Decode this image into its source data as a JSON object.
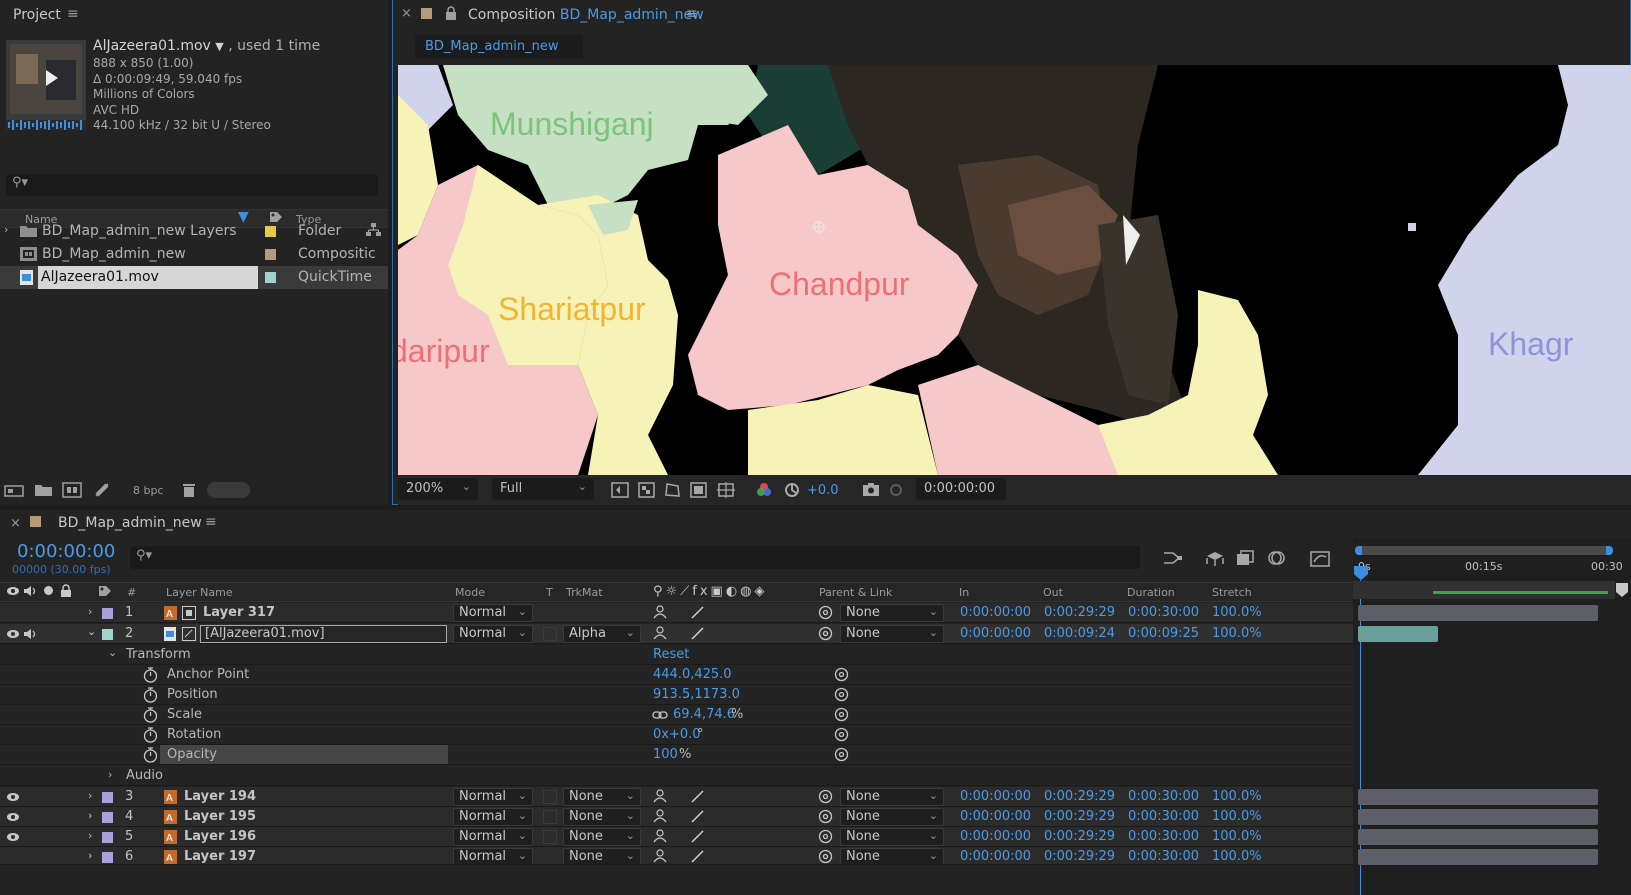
{
  "project": {
    "tab": "Project",
    "footage": {
      "name": "AlJazeera01.mov",
      "used": ", used 1 time",
      "dims": "888 x 850 (1.00)",
      "duration": "Δ 0:00:09:49, 59.040 fps",
      "colors": "Millions of Colors",
      "codec": "AVC HD",
      "audio": "44.100 kHz / 32 bit U / Stereo"
    },
    "col_name": "Name",
    "col_type": "Type",
    "items": [
      {
        "name": "BD_Map_admin_new Layers",
        "type": "Folder",
        "color": "#e6c84a"
      },
      {
        "name": "BD_Map_admin_new",
        "type": "Compositic",
        "color": "#b59b7a"
      },
      {
        "name": "AlJazeera01.mov",
        "type": "QuickTime",
        "color": "#9fd3cf"
      }
    ],
    "bpc": "8 bpc"
  },
  "comp": {
    "tab_prefix": "Composition",
    "tab_name": "BD_Map_admin_new",
    "subtab": "BD_Map_admin_new",
    "map_labels": [
      "Munshiganj",
      "Chandpur",
      "Shariatpur",
      "daripur",
      "Khagr"
    ],
    "zoom": "200%",
    "resolution": "Full",
    "exposure": "+0.0",
    "timecode": "0:00:00:00"
  },
  "timeline": {
    "tab": "BD_Map_admin_new",
    "current_time": "0:00:00:00",
    "frame_info": "00000 (30.00 fps)",
    "headers": {
      "hash": "#",
      "layer_name": "Layer Name",
      "mode": "Mode",
      "t": "T",
      "trkmat": "TrkMat",
      "parent": "Parent & Link",
      "in": "In",
      "out": "Out",
      "duration": "Duration",
      "stretch": "Stretch"
    },
    "ruler": [
      "0s",
      "00:15s",
      "00:30"
    ],
    "layers": [
      {
        "num": "1",
        "name": "Layer 317",
        "mode": "Normal",
        "trkmat": "",
        "parent": "None",
        "in": "0:00:00:00",
        "out": "0:00:29:29",
        "duration": "0:00:30:00",
        "stretch": "100.0%",
        "color": "#a9a1d9"
      },
      {
        "num": "2",
        "name": "[AlJazeera01.mov]",
        "mode": "Normal",
        "trkmat": "Alpha",
        "parent": "None",
        "in": "0:00:00:00",
        "out": "0:00:09:24",
        "duration": "0:00:09:25",
        "stretch": "100.0%",
        "color": "#9fd3cf"
      },
      {
        "num": "3",
        "name": "Layer 194",
        "mode": "Normal",
        "trkmat": "None",
        "parent": "None",
        "in": "0:00:00:00",
        "out": "0:00:29:29",
        "duration": "0:00:30:00",
        "stretch": "100.0%",
        "color": "#a9a1d9"
      },
      {
        "num": "4",
        "name": "Layer 195",
        "mode": "Normal",
        "trkmat": "None",
        "parent": "None",
        "in": "0:00:00:00",
        "out": "0:00:29:29",
        "duration": "0:00:30:00",
        "stretch": "100.0%",
        "color": "#a9a1d9"
      },
      {
        "num": "5",
        "name": "Layer 196",
        "mode": "Normal",
        "trkmat": "None",
        "parent": "None",
        "in": "0:00:00:00",
        "out": "0:00:29:29",
        "duration": "0:00:30:00",
        "stretch": "100.0%",
        "color": "#a9a1d9"
      },
      {
        "num": "6",
        "name": "Layer 197",
        "mode": "Normal",
        "trkmat": "None",
        "parent": "None",
        "in": "0:00:00:00",
        "out": "0:00:29:29",
        "duration": "0:00:30:00",
        "stretch": "100.0%",
        "color": "#a9a1d9"
      }
    ],
    "transform": {
      "label": "Transform",
      "reset": "Reset",
      "anchor_label": "Anchor Point",
      "anchor_value": "444.0,425.0",
      "position_label": "Position",
      "position_value": "913.5,1173.0",
      "scale_label": "Scale",
      "scale_value": "69.4,74.6",
      "scale_unit": "%",
      "rotation_label": "Rotation",
      "rotation_value": "0x+0.0",
      "rotation_unit": "°",
      "opacity_label": "Opacity",
      "opacity_value": "100",
      "opacity_unit": "%"
    },
    "audio_label": "Audio"
  }
}
